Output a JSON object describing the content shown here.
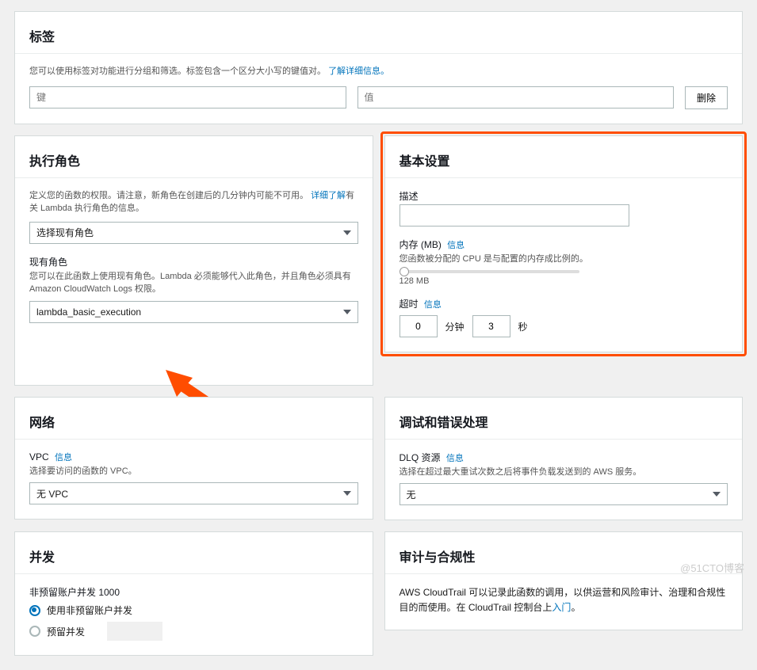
{
  "tags": {
    "title": "标签",
    "hint": "您可以使用标签对功能进行分组和筛选。标签包含一个区分大小写的键值对。",
    "learn_more": "了解详细信息。",
    "key_placeholder": "键",
    "value_placeholder": "值",
    "delete_btn": "删除"
  },
  "exec_role": {
    "title": "执行角色",
    "hint_main": "定义您的函数的权限。请注意，新角色在创建后的几分钟内可能不可用。",
    "hint_link": "详细了解",
    "hint_suffix": "有关 Lambda 执行角色的信息。",
    "choose_label": "选择现有角色",
    "existing_label": "现有角色",
    "existing_hint": "您可以在此函数上使用现有角色。Lambda 必须能够代入此角色，并且角色必须具有 Amazon CloudWatch Logs 权限。",
    "role_value": "lambda_basic_execution"
  },
  "basic": {
    "title": "基本设置",
    "desc_label": "描述",
    "mem_label": "内存 (MB)",
    "info": "信息",
    "mem_hint": "您函数被分配的 CPU 是与配置的内存成比例的。",
    "mem_value": "128 MB",
    "timeout_label": "超时",
    "minutes_value": "0",
    "minutes_unit": "分钟",
    "seconds_value": "3",
    "seconds_unit": "秒"
  },
  "network": {
    "title": "网络",
    "vpc_label": "VPC",
    "info": "信息",
    "vpc_hint": "选择要访问的函数的 VPC。",
    "vpc_value": "无 VPC"
  },
  "debug": {
    "title": "调试和错误处理",
    "dlq_label": "DLQ 资源",
    "info": "信息",
    "dlq_hint": "选择在超过最大重试次数之后将事件负载发送到的 AWS 服务。",
    "dlq_value": "无"
  },
  "concurrency": {
    "title": "并发",
    "unreserved_label": "非预留账户并发 1000",
    "opt_unreserved": "使用非预留账户并发",
    "opt_reserved": "预留并发"
  },
  "audit": {
    "title": "审计与合规性",
    "text_prefix": "AWS CloudTrail 可以记录此函数的调用，以供运营和风险审计、治理和合规性目的而使用。在 CloudTrail 控制台上",
    "link": "入门",
    "text_suffix": "。"
  },
  "watermark": "@51CTO博客"
}
